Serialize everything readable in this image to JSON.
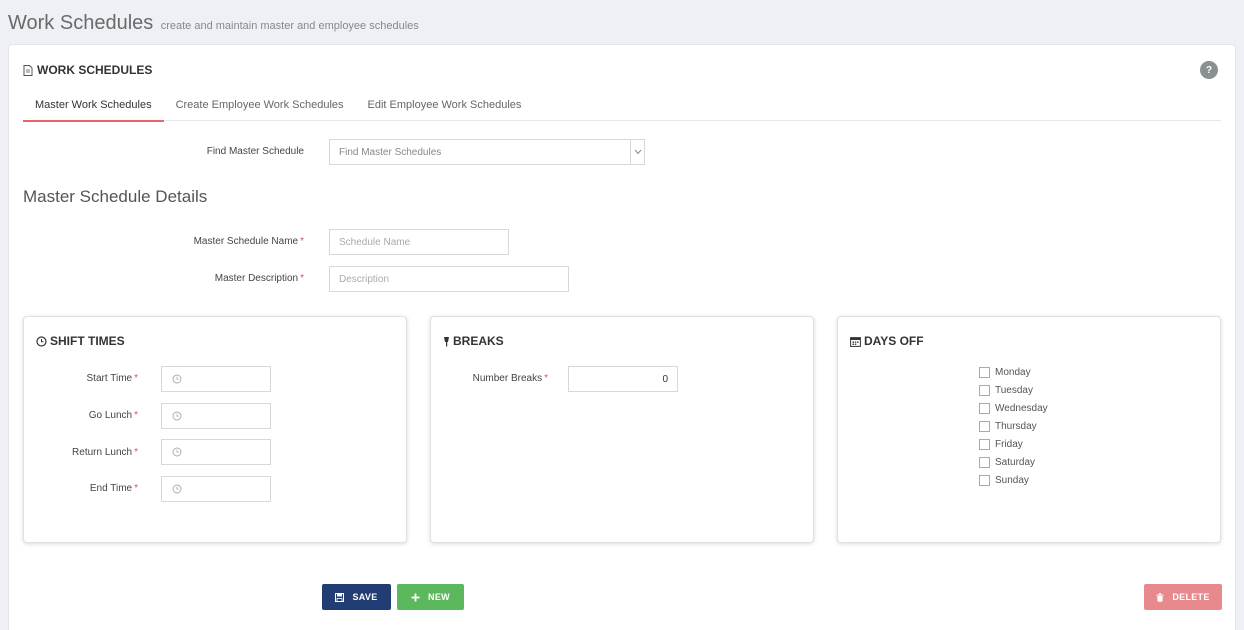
{
  "header": {
    "title": "Work Schedules",
    "subtitle": "create and maintain master and employee schedules"
  },
  "card": {
    "title": "WORK SCHEDULES",
    "help": "?"
  },
  "tabs": [
    {
      "label": "Master Work Schedules",
      "active": true
    },
    {
      "label": "Create Employee Work Schedules",
      "active": false
    },
    {
      "label": "Edit Employee Work Schedules",
      "active": false
    }
  ],
  "find": {
    "label": "Find Master Schedule",
    "placeholder": "Find Master Schedules"
  },
  "details": {
    "title": "Master Schedule Details",
    "name_label": "Master Schedule Name",
    "name_placeholder": "Schedule Name",
    "desc_label": "Master Description",
    "desc_placeholder": "Description",
    "required_mark": "*"
  },
  "shift_times": {
    "title": "SHIFT TIMES",
    "fields": [
      {
        "label": "Start Time"
      },
      {
        "label": "Go Lunch"
      },
      {
        "label": "Return Lunch"
      },
      {
        "label": "End Time"
      }
    ]
  },
  "breaks": {
    "title": "BREAKS",
    "label": "Number Breaks",
    "value": "0"
  },
  "days_off": {
    "title": "DAYS OFF",
    "days": [
      "Monday",
      "Tuesday",
      "Wednesday",
      "Thursday",
      "Friday",
      "Saturday",
      "Sunday"
    ]
  },
  "buttons": {
    "save": "SAVE",
    "new": "NEW",
    "delete": "DELETE"
  },
  "colors": {
    "tab_accent": "#e9636a",
    "save": "#223c74",
    "new": "#5cb85c",
    "delete": "#e8898d",
    "required": "#d9534f"
  }
}
